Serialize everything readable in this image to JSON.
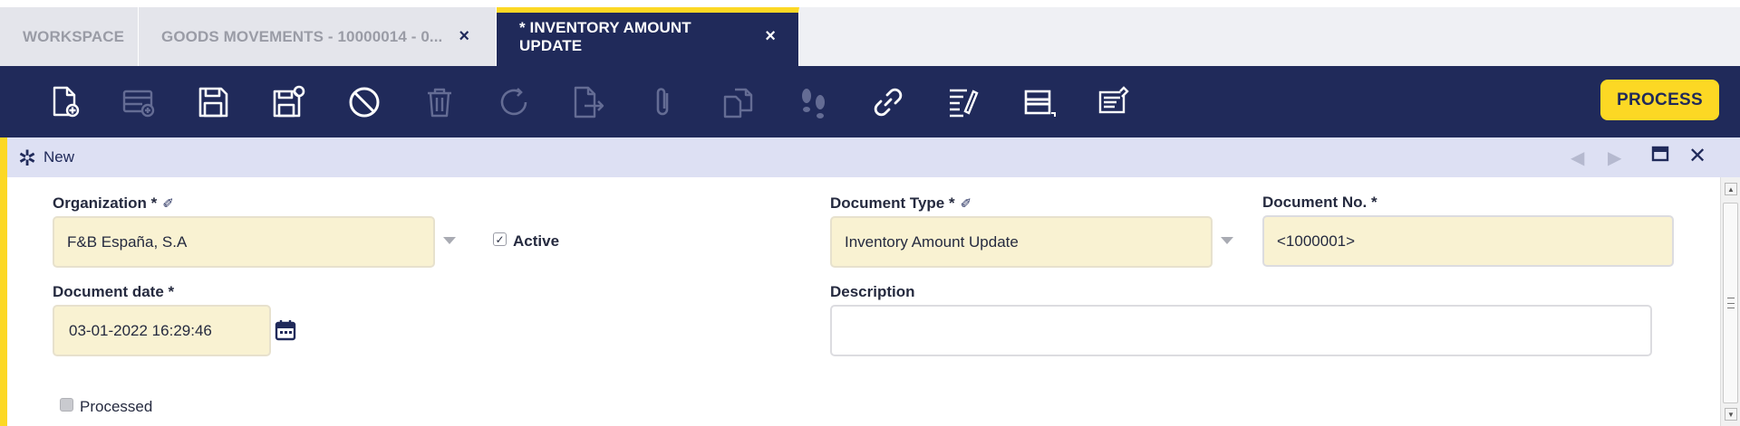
{
  "tabs": [
    {
      "label": "WORKSPACE",
      "closable": false
    },
    {
      "label": "GOODS MOVEMENTS - 10000014 - 0...",
      "closable": true
    },
    {
      "label": "* INVENTORY AMOUNT UPDATE",
      "closable": true,
      "active": true
    }
  ],
  "tab_close_glyph": "×",
  "toolbar": {
    "icons": [
      "new-document-icon",
      "new-row-icon",
      "save-icon",
      "save-close-icon",
      "undo-cancel-icon",
      "delete-icon",
      "refresh-icon",
      "export-icon",
      "attachment-icon",
      "copy-icon",
      "audit-trail-icon",
      "link-icon",
      "tree-edit-icon",
      "toggle-form-icon",
      "notes-icon"
    ],
    "process_label": "PROCESS"
  },
  "form": {
    "status": "New",
    "organization": {
      "label": "Organization *",
      "value": "F&B España, S.A"
    },
    "active": {
      "label": "Active",
      "checked": true
    },
    "document_type": {
      "label": "Document Type *",
      "value": "Inventory Amount Update"
    },
    "document_no": {
      "label": "Document No. *",
      "value": "<1000001>"
    },
    "document_date": {
      "label": "Document date *",
      "value": "03-01-2022 16:29:46"
    },
    "description": {
      "label": "Description",
      "value": ""
    },
    "processed": {
      "label": "Processed",
      "checked": false
    }
  },
  "colors": {
    "navy": "#202a5a",
    "accent": "#fcd824",
    "field_bg": "#f9f2d2",
    "header_bg": "#dde0f3"
  }
}
